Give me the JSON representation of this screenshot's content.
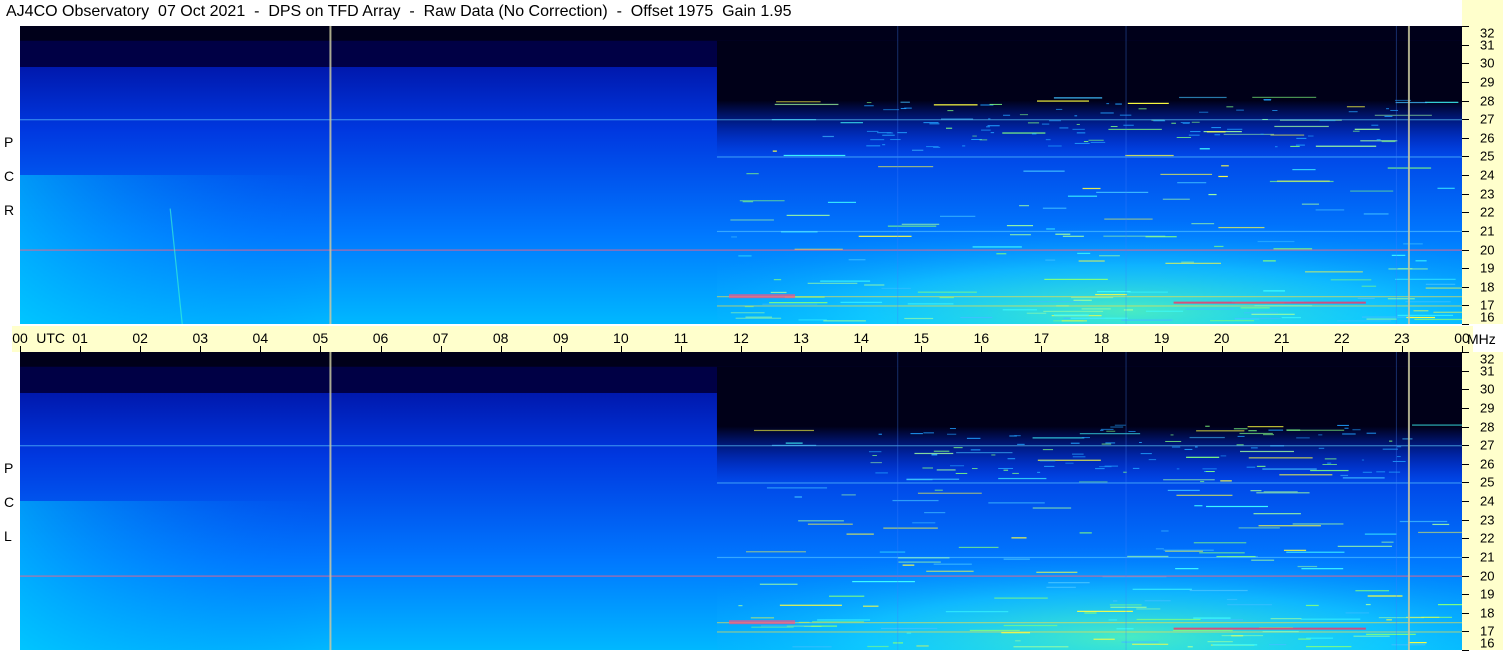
{
  "title": "AJ4CO Observatory  07 Oct 2021  -  DPS on TFD Array  -  Raw Data (No Correction)  -  Offset 1975  Gain 1.95",
  "chart_data": {
    "type": "heatmap",
    "title": "AJ4CO Observatory  07 Oct 2021  -  DPS on TFD Array  -  Raw Data (No Correction)  -  Offset 1975  Gain 1.95",
    "x_axis": {
      "unit_label": "UTC",
      "range_hours": [
        0,
        24
      ],
      "tick_labels": [
        "00",
        "01",
        "02",
        "03",
        "04",
        "05",
        "06",
        "07",
        "08",
        "09",
        "10",
        "11",
        "12",
        "13",
        "14",
        "15",
        "16",
        "17",
        "18",
        "19",
        "20",
        "21",
        "22",
        "23",
        "00"
      ]
    },
    "y_axis": {
      "unit_label": "MHz",
      "range_mhz": [
        16,
        32
      ],
      "tick_labels": [
        "32",
        "31",
        "30",
        "29",
        "28",
        "27",
        "26",
        "25",
        "24",
        "23",
        "22",
        "21",
        "20",
        "19",
        "18",
        "17",
        "16"
      ]
    },
    "panels": [
      {
        "id": "rcp",
        "side_label": [
          "P",
          "C",
          "R"
        ],
        "name": "RCP"
      },
      {
        "id": "lcp",
        "side_label": [
          "P",
          "C",
          "L"
        ],
        "name": "LCP"
      }
    ],
    "features": {
      "vertical_markers_utc": [
        5.15,
        23.1
      ],
      "day_night_transition_utc": 11.6,
      "persistent_carrier_mhz": [
        20.0,
        27.0,
        25.0,
        21.0,
        17.5,
        17.0
      ],
      "colormap": [
        "#000022",
        "#0000c8",
        "#0050ff",
        "#00c8ff",
        "#40ffb0",
        "#ffff40",
        "#ff4040"
      ]
    }
  },
  "colors": {
    "axis_background": "#ffffcc",
    "marker_line": "#c8c8a0"
  }
}
